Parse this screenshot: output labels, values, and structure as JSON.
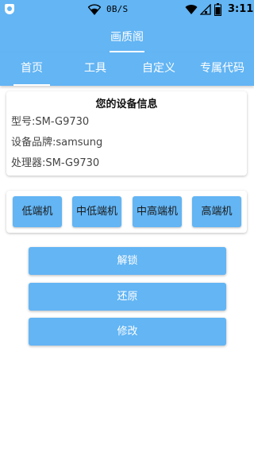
{
  "status_bar": {
    "network_speed": "0B/S",
    "time": "3:11",
    "icons": [
      "app-notification-icon",
      "wifi-icon",
      "wifi-signal-icon",
      "cell-signal-icon",
      "battery-icon"
    ]
  },
  "app": {
    "title": "画质阁"
  },
  "tabs": [
    {
      "label": "首页"
    },
    {
      "label": "工具"
    },
    {
      "label": "自定义"
    },
    {
      "label": "专属代码"
    }
  ],
  "device_info": {
    "title": "您的设备信息",
    "model": "型号:SM-G9730",
    "brand": "设备品牌:samsung",
    "processor": "处理器:SM-G9730"
  },
  "levels": [
    {
      "label": "低端机"
    },
    {
      "label": "中低端机"
    },
    {
      "label": "中高端机"
    },
    {
      "label": "高端机"
    }
  ],
  "actions": {
    "unlock": "解锁",
    "restore": "还原",
    "modify": "修改"
  },
  "colors": {
    "primary": "#63b5f4",
    "text_dark": "#111111",
    "text_muted": "#444444"
  }
}
